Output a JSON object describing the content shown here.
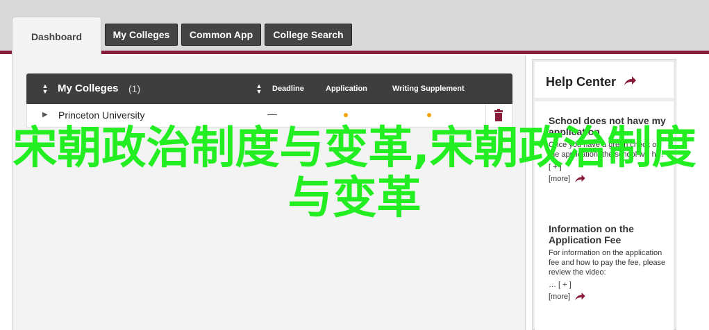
{
  "tabs": {
    "active": "Dashboard",
    "buttons": [
      "My Colleges",
      "Common App",
      "College Search"
    ]
  },
  "table": {
    "title": "My Colleges",
    "count": "(1)",
    "columns": [
      "Deadline",
      "Application",
      "Writing Supplement"
    ],
    "rows": [
      {
        "name": "Princeton University",
        "deadline": "—"
      }
    ]
  },
  "help": {
    "title": "Help Center",
    "articles": [
      {
        "title": "School does not have my application",
        "body": "Once you have a green check on the application, the school will h…",
        "expand": "[ + ]",
        "more": "[more]"
      },
      {
        "title": "Information on the Application Fee",
        "body": "For information on the application fee and how to pay the fee, please review the video:",
        "expand": "… [ + ]",
        "more": "[more]"
      }
    ]
  },
  "overlay_text": "宋朝政治制度与变革,宋朝政治制度与变革",
  "colors": {
    "accent_bar": "#8a1c3a",
    "status_dot": "#f4a000",
    "overlay": "#22ee22"
  }
}
